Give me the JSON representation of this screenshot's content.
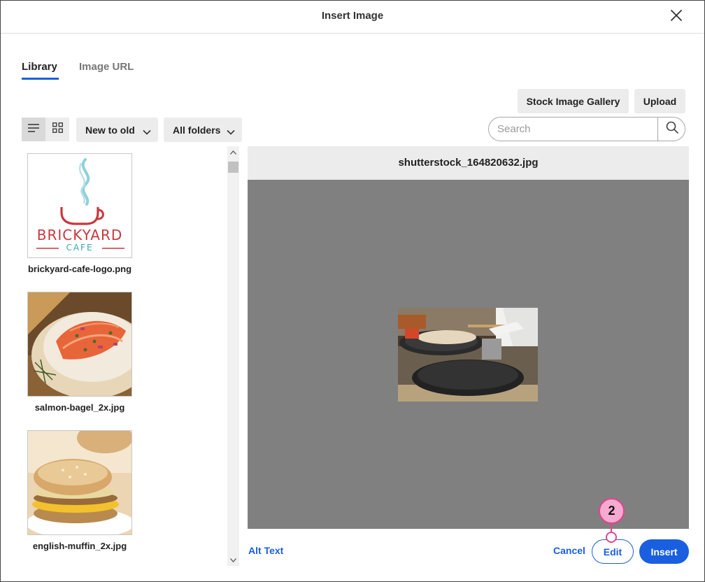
{
  "dialog": {
    "title": "Insert Image"
  },
  "tabs": [
    {
      "label": "Library",
      "active": true
    },
    {
      "label": "Image URL",
      "active": false
    }
  ],
  "actions": {
    "stock_gallery": "Stock Image Gallery",
    "upload": "Upload"
  },
  "toolbar": {
    "sort": "New to old",
    "folder": "All folders",
    "search_placeholder": "Search",
    "search_value": ""
  },
  "library": {
    "items": [
      {
        "name": "brickyard-cafe-logo.png",
        "logo_word1": "BRICKYARD",
        "logo_word2": "CAFE"
      },
      {
        "name": "salmon-bagel_2x.jpg"
      },
      {
        "name": "english-muffin_2x.jpg"
      }
    ]
  },
  "preview": {
    "filename": "shutterstock_164820632.jpg"
  },
  "footer": {
    "alt_text": "Alt Text",
    "cancel": "Cancel",
    "edit": "Edit",
    "insert": "Insert"
  },
  "annotation": {
    "step": "2"
  },
  "colors": {
    "accent": "#1a5fe0",
    "callout_fill": "#f7a9d0",
    "callout_border": "#e0458f",
    "preview_bg": "#808080",
    "logo_red": "#c8383e",
    "logo_teal": "#3aa6b2"
  }
}
